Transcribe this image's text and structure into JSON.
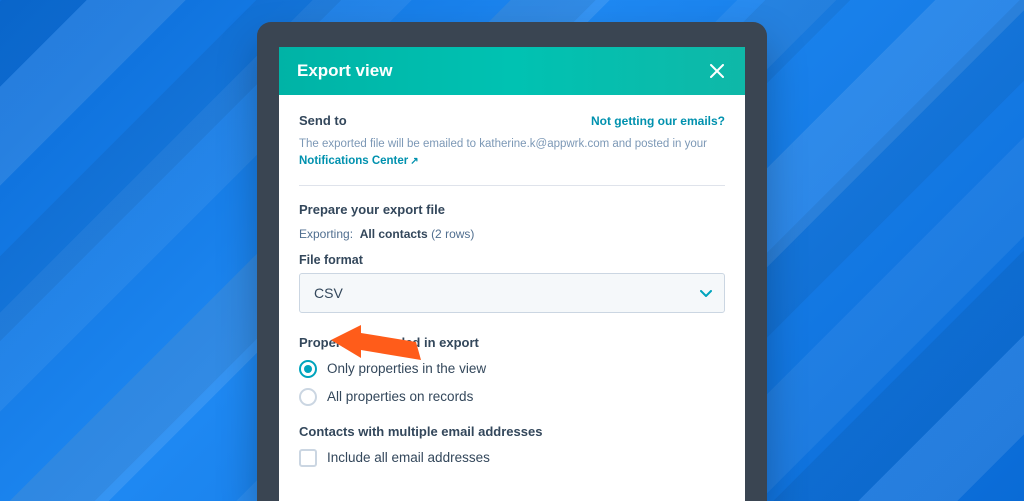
{
  "modal": {
    "title": "Export view",
    "send_to_label": "Send to",
    "not_getting_emails": "Not getting our emails?",
    "desc_prefix": "The exported file will be emailed to katherine.k@appwrk.com and posted in your ",
    "desc_link": "Notifications Center",
    "prepare_label": "Prepare your export file",
    "exporting_prefix": "Exporting:",
    "exporting_target": "All contacts",
    "exporting_suffix": "(2 rows)",
    "file_format_label": "File format",
    "file_format_value": "CSV",
    "properties_label": "Properties included in export",
    "radio_options": [
      {
        "label": "Only properties in the view",
        "checked": true
      },
      {
        "label": "All properties on records",
        "checked": false
      }
    ],
    "multi_email_label": "Contacts with multiple email addresses",
    "checkbox_label": "Include all email addresses"
  }
}
